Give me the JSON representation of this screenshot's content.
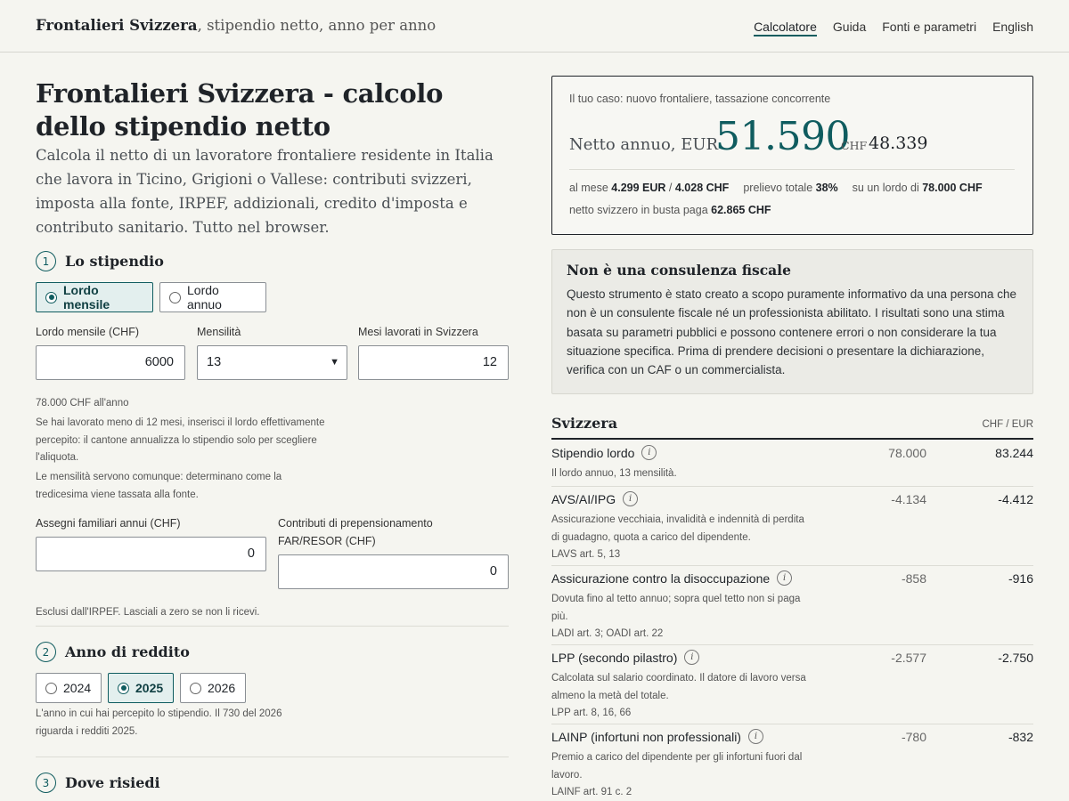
{
  "header": {
    "brand_bold": "Frontalieri Svizzera",
    "brand_rest": ", stipendio netto, anno per anno",
    "nav": [
      "Calcolatore",
      "Guida",
      "Fonti e parametri",
      "English"
    ]
  },
  "page": {
    "title": "Frontalieri Svizzera - calcolo dello stipendio netto",
    "lead": "Calcola il netto di un lavoratore frontaliere residente in Italia che lavora in Ticino, Grigioni o Vallese: contributi svizzeri, imposta alla fonte, IRPEF, addizionali, credito d'imposta e contributo sanitario. Tutto nel browser."
  },
  "step1": {
    "num": "1",
    "title": "Lo stipendio",
    "mode_options": [
      "Lordo mensile",
      "Lordo annuo"
    ],
    "gross_label": "Lordo mensile (CHF)",
    "gross_value": "6000",
    "months_label": "Mensilità",
    "months_value": "13",
    "worked_label": "Mesi lavorati in Svizzera",
    "worked_value": "12",
    "annual_note": "78.000 CHF all'anno",
    "note1": "Se hai lavorato meno di 12 mesi, inserisci il lordo effettivamente percepito: il cantone annualizza lo stipendio solo per scegliere l'aliquota.",
    "note2": "Le mensilità servono comunque: determinano come la tredicesima viene tassata alla fonte.",
    "family_label": "Assegni familiari annui (CHF)",
    "family_value": "0",
    "pension_label": "Contributi di prepensionamento FAR/RESOR (CHF)",
    "pension_value": "0",
    "excluded_note": "Esclusi dall'IRPEF. Lasciali a zero se non li ricevi."
  },
  "step2": {
    "num": "2",
    "title": "Anno di reddito",
    "years": [
      "2024",
      "2025",
      "2026"
    ],
    "note": "L'anno in cui hai percepito lo stipendio. Il 730 del 2026 riguarda i redditi 2025."
  },
  "step3": {
    "num": "3",
    "title": "Dove risiedi"
  },
  "result": {
    "case": "Il tuo caso: nuovo frontaliere, tassazione concorrente",
    "net_label": "Netto annuo, EUR",
    "net_eur": "51.590",
    "chf_label": "CHF",
    "net_chf": "48.339",
    "month_label": "al mese",
    "month_eur": "4.299 EUR",
    "month_sep": "/",
    "month_chf": "4.028 CHF",
    "levy_label": "prelievo totale",
    "levy_value": "38%",
    "gross_label": "su un lordo di",
    "gross_value": "78.000 CHF",
    "swiss_label": "netto svizzero in busta paga",
    "swiss_value": "62.865 CHF"
  },
  "disclaimer": {
    "title": "Non è una consulenza fiscale",
    "text": "Questo strumento è stato creato a scopo puramente informativo da una persona che non è un consulente fiscale né un professionista abilitato. I risultati sono una stima basata su parametri pubblici e possono contenere errori o non considerare la tua situazione specifica. Prima di prendere decisioni o presentare la dichiarazione, verifica con un CAF o un commercialista."
  },
  "table": {
    "title": "Svizzera",
    "currency": "CHF / EUR",
    "rows": [
      {
        "name": "Stipendio lordo",
        "desc": "Il lordo annuo, 13 mensilità.",
        "ref": "",
        "chf": "78.000",
        "eur": "83.244"
      },
      {
        "name": "AVS/AI/IPG",
        "desc": "Assicurazione vecchiaia, invalidità e indennità di perdita di guadagno, quota a carico del dipendente.",
        "ref": "LAVS art. 5, 13",
        "chf": "-4.134",
        "eur": "-4.412"
      },
      {
        "name": "Assicurazione contro la disoccupazione",
        "desc": "Dovuta fino al tetto annuo; sopra quel tetto non si paga più.",
        "ref": "LADI art. 3; OADI art. 22",
        "chf": "-858",
        "eur": "-916"
      },
      {
        "name": "LPP (secondo pilastro)",
        "desc": "Calcolata sul salario coordinato. Il datore di lavoro versa almeno la metà del totale.",
        "ref": "LPP art. 8, 16, 66",
        "chf": "-2.577",
        "eur": "-2.750"
      },
      {
        "name": "LAINP (infortuni non professionali)",
        "desc": "Premio a carico del dipendente per gli infortuni fuori dal lavoro.",
        "ref": "LAINF art. 91 c. 2",
        "chf": "-780",
        "eur": "-832"
      }
    ]
  },
  "icons": {
    "info": "info-icon",
    "select": "chevron-down-icon"
  },
  "colors": {
    "accent": "#0f5c5f",
    "background": "#f5f5f0",
    "selected_bg": "#e3efee"
  }
}
